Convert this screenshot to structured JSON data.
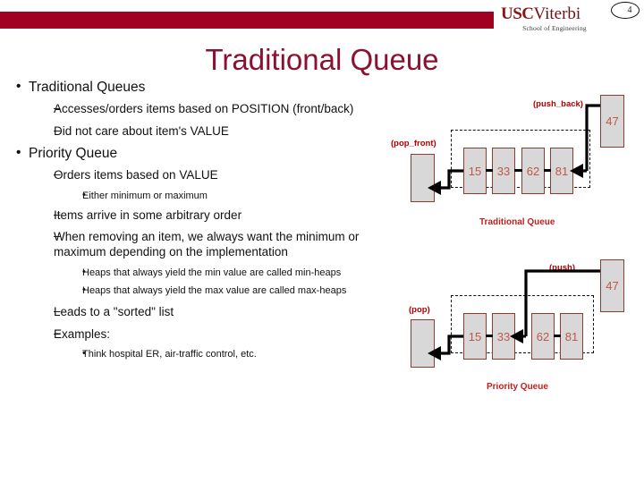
{
  "header": {
    "logo_usc": "USC",
    "logo_viterbi": "Viterbi",
    "logo_sub": "School of Engineering",
    "slide_number": "4",
    "bar_color": "#a10022"
  },
  "title": "Traditional Queue",
  "bullets": [
    {
      "level": 1,
      "marker": "•",
      "text": "Traditional Queues"
    },
    {
      "level": 2,
      "marker": "–",
      "text": "Accesses/orders items based on POSITION (front/back)"
    },
    {
      "level": 2,
      "marker": "–",
      "text": "Did not care about item's VALUE"
    },
    {
      "level": 1,
      "marker": "•",
      "text": "Priority Queue"
    },
    {
      "level": 2,
      "marker": "–",
      "text": "Orders items based on VALUE"
    },
    {
      "level": 3,
      "marker": "•",
      "text": "Either minimum or maximum"
    },
    {
      "level": 2,
      "marker": "–",
      "text": "Items arrive in some arbitrary order"
    },
    {
      "level": 2,
      "marker": "–",
      "text": "When removing an item, we always want the minimum or maximum depending on the implementation"
    },
    {
      "level": 3,
      "marker": "•",
      "text": "Heaps that always yield the min value are called min-heaps"
    },
    {
      "level": 3,
      "marker": "•",
      "text": "Heaps that always yield the max value are called max-heaps"
    },
    {
      "level": 2,
      "marker": "–",
      "text": "Leads to a \"sorted\" list"
    },
    {
      "level": 2,
      "marker": "–",
      "text": "Examples:"
    },
    {
      "level": 3,
      "marker": "•",
      "text": "Think hospital ER, air-traffic control, etc."
    }
  ],
  "diagrams": [
    {
      "id": "traditional-queue",
      "caption": "Traditional Queue",
      "push_label": "(push_back)",
      "pop_label": "(pop_front)",
      "queue_values": [
        "15",
        "33",
        "62",
        "81"
      ],
      "incoming_value": "47",
      "insert_after_index": 4
    },
    {
      "id": "priority-queue",
      "caption": "Priority Queue",
      "push_label": "(push)",
      "pop_label": "(pop)",
      "queue_values": [
        "15",
        "33",
        "62",
        "81"
      ],
      "incoming_value": "47",
      "insert_after_index": 2
    }
  ],
  "colors": {
    "usc_cardinal": "#a10022",
    "title_maroon": "#8c1030",
    "label_red": "#b00000",
    "caption_red": "#c22020",
    "cell_fill": "#d8d8d8",
    "cell_text": "#c0564c"
  }
}
